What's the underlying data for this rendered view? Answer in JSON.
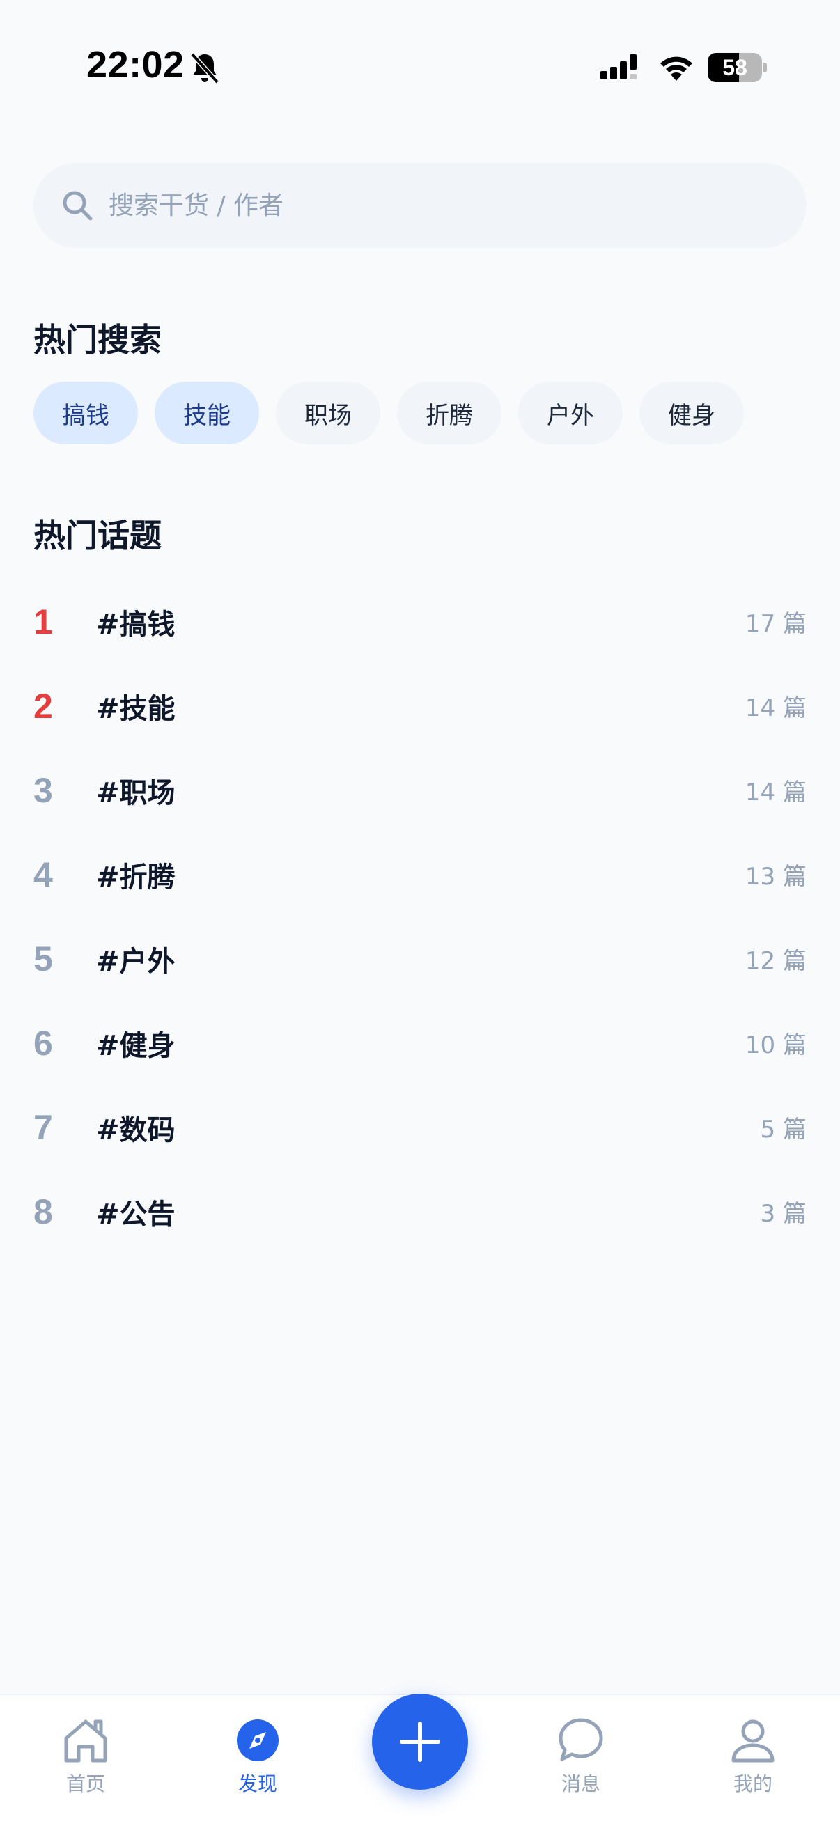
{
  "status_bar": {
    "time": "22:02",
    "battery_level": "58",
    "battery_fraction": 0.58
  },
  "search": {
    "placeholder": "搜索干货 / 作者",
    "icon": "search-icon"
  },
  "hot_search": {
    "title": "热门搜索",
    "tags": [
      {
        "label": "搞钱",
        "active": true
      },
      {
        "label": "技能",
        "active": true
      },
      {
        "label": "职场",
        "active": false
      },
      {
        "label": "折腾",
        "active": false
      },
      {
        "label": "户外",
        "active": false
      },
      {
        "label": "健身",
        "active": false
      }
    ]
  },
  "hot_topics": {
    "title": "热门话题",
    "items": [
      {
        "rank": "1",
        "name": "#搞钱",
        "count": "17 篇"
      },
      {
        "rank": "2",
        "name": "#技能",
        "count": "14 篇"
      },
      {
        "rank": "3",
        "name": "#职场",
        "count": "14 篇"
      },
      {
        "rank": "4",
        "name": "#折腾",
        "count": "13 篇"
      },
      {
        "rank": "5",
        "name": "#户外",
        "count": "12 篇"
      },
      {
        "rank": "6",
        "name": "#健身",
        "count": "10 篇"
      },
      {
        "rank": "7",
        "name": "#数码",
        "count": "5 篇"
      },
      {
        "rank": "8",
        "name": "#公告",
        "count": "3 篇"
      }
    ]
  },
  "bottom_nav": {
    "items": [
      {
        "label": "首页",
        "icon": "home-icon",
        "active": false
      },
      {
        "label": "发现",
        "icon": "compass-icon",
        "active": true
      },
      {
        "label": "消息",
        "icon": "chat-bubble-icon",
        "active": false
      },
      {
        "label": "我的",
        "icon": "user-icon",
        "active": false
      }
    ],
    "fab_icon": "plus-icon"
  },
  "colors": {
    "accent": "#2563eb",
    "rank_highlight": "#e53e3e",
    "muted": "#94a3b8",
    "tag_active_bg": "#dbeafe",
    "tag_bg": "#f1f5f9",
    "page_bg": "#f8fafc"
  }
}
